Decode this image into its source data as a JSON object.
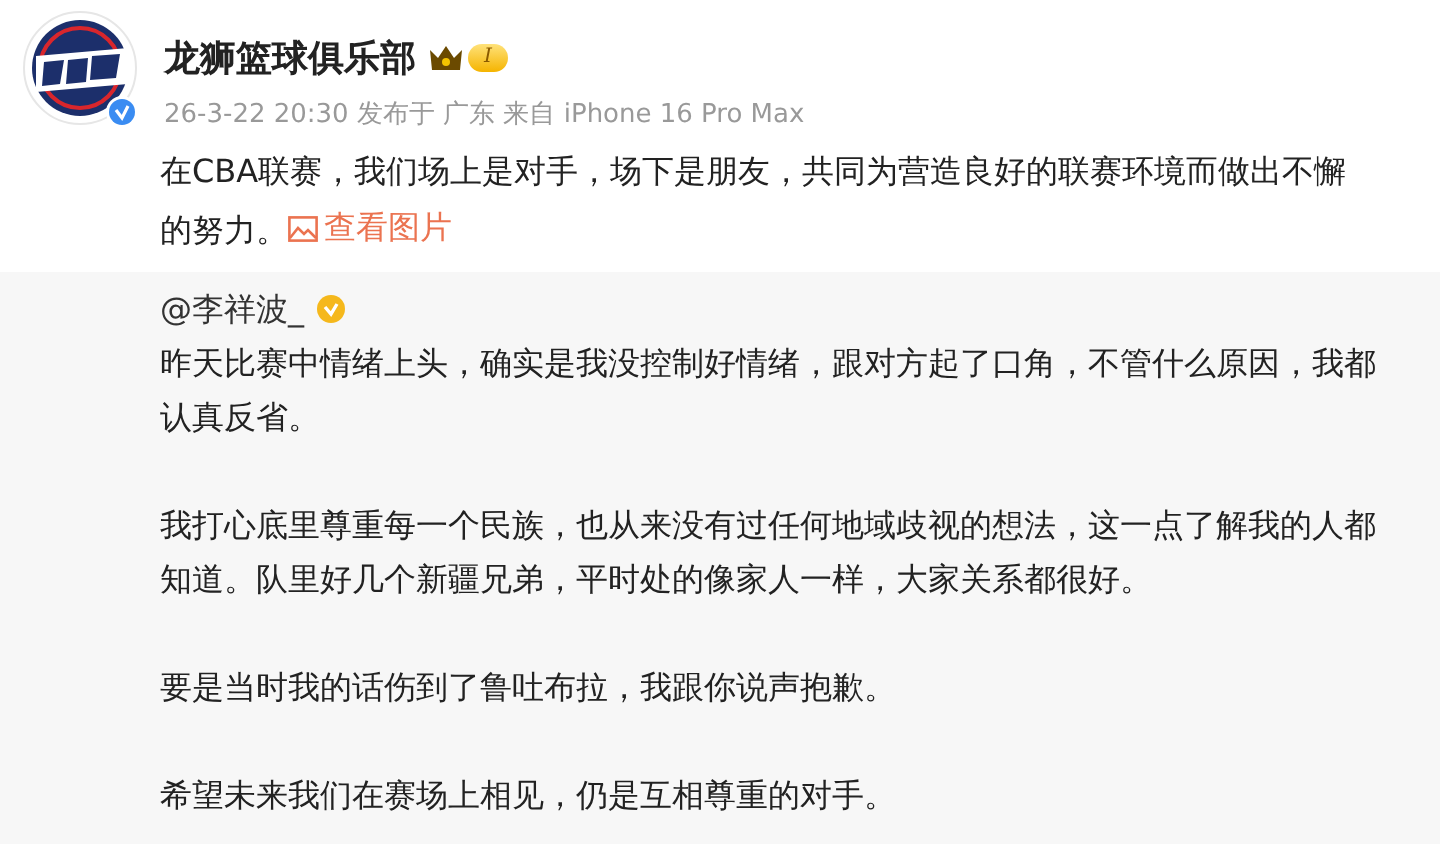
{
  "post": {
    "author": "龙狮篮球俱乐部",
    "level_badge": "I",
    "meta": "26-3-22 20:30 发布于 广东 来自 iPhone 16 Pro Max",
    "text": "在CBA联赛，我们场上是对手，场下是朋友，共同为营造良好的联赛环境而做出不懈的努力。",
    "link": "查看图片"
  },
  "repost": {
    "author": "@李祥波_",
    "paragraphs": [
      "昨天比赛中情绪上头，确实是我没控制好情绪，跟对方起了口角，不管什么原因，我都认真反省。",
      "我打心底里尊重每一个民族，也从来没有过任何地域歧视的想法，这一点了解我的人都知道。队里好几个新疆兄弟，平时处的像家人一样，大家关系都很好。",
      "要是当时我的话伤到了鲁吐布拉，我跟你说声抱歉。",
      "希望未来我们在赛场上相见，仍是互相尊重的对手。"
    ]
  }
}
